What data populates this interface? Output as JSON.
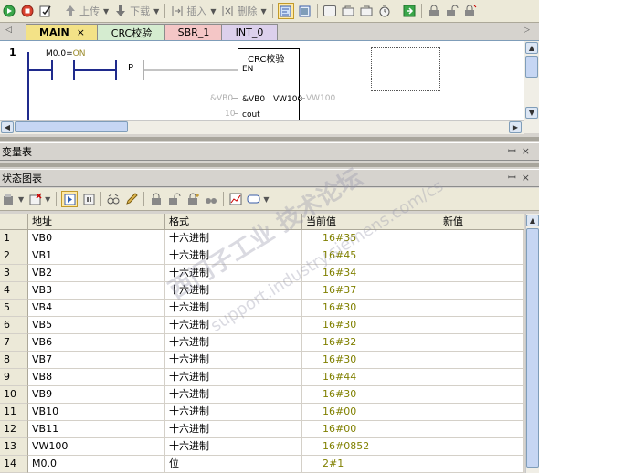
{
  "toolbar": {
    "upload_label": "上传",
    "download_label": "下载",
    "insert_label": "插入",
    "delete_label": "删除"
  },
  "tabs": [
    {
      "label": "MAIN",
      "color": "#f3e287",
      "active": true
    },
    {
      "label": "CRC校验",
      "color": "#d5ecd0"
    },
    {
      "label": "SBR_1",
      "color": "#f4c6c6"
    },
    {
      "label": "INT_0",
      "color": "#dcd0ec"
    }
  ],
  "tab_close": "×",
  "ladder": {
    "network_number": "1",
    "contact_address": "M0.0",
    "contact_eq": "=",
    "contact_state": "ON",
    "p_label": "P",
    "box_title": "CRC校验",
    "en_label": "EN",
    "in_prefix": "&VB0",
    "in_pin": "&VB0",
    "out_pin": "VW100",
    "out_value": "VW100",
    "count_value": "10",
    "count_pin": "cout"
  },
  "panels": {
    "var_table_title": "变量表",
    "status_chart_title": "状态图表",
    "pin_icon": "ꟷ",
    "close_icon": "×"
  },
  "status_table": {
    "columns": [
      "地址",
      "格式",
      "当前值",
      "新值"
    ],
    "rows": [
      {
        "n": "1",
        "addr": "VB0",
        "fmt": "十六进制",
        "cur": "16#35",
        "new": ""
      },
      {
        "n": "2",
        "addr": "VB1",
        "fmt": "十六进制",
        "cur": "16#45",
        "new": ""
      },
      {
        "n": "3",
        "addr": "VB2",
        "fmt": "十六进制",
        "cur": "16#34",
        "new": ""
      },
      {
        "n": "4",
        "addr": "VB3",
        "fmt": "十六进制",
        "cur": "16#37",
        "new": ""
      },
      {
        "n": "5",
        "addr": "VB4",
        "fmt": "十六进制",
        "cur": "16#30",
        "new": ""
      },
      {
        "n": "6",
        "addr": "VB5",
        "fmt": "十六进制",
        "cur": "16#30",
        "new": ""
      },
      {
        "n": "7",
        "addr": "VB6",
        "fmt": "十六进制",
        "cur": "16#32",
        "new": ""
      },
      {
        "n": "8",
        "addr": "VB7",
        "fmt": "十六进制",
        "cur": "16#30",
        "new": ""
      },
      {
        "n": "9",
        "addr": "VB8",
        "fmt": "十六进制",
        "cur": "16#44",
        "new": ""
      },
      {
        "n": "10",
        "addr": "VB9",
        "fmt": "十六进制",
        "cur": "16#30",
        "new": ""
      },
      {
        "n": "11",
        "addr": "VB10",
        "fmt": "十六进制",
        "cur": "16#00",
        "new": ""
      },
      {
        "n": "12",
        "addr": "VB11",
        "fmt": "十六进制",
        "cur": "16#00",
        "new": ""
      },
      {
        "n": "13",
        "addr": "VW100",
        "fmt": "十六进制",
        "cur": "16#0852",
        "new": ""
      },
      {
        "n": "14",
        "addr": "M0.0",
        "fmt": "位",
        "cur": "2#1",
        "new": ""
      }
    ]
  },
  "watermark": {
    "line1": "西门子工业 技术论坛",
    "line2": "support.industry.siemens.com/cs"
  },
  "colors": {
    "accent_current_value": "#808000",
    "ladder_wire": "#1f2a8c"
  }
}
